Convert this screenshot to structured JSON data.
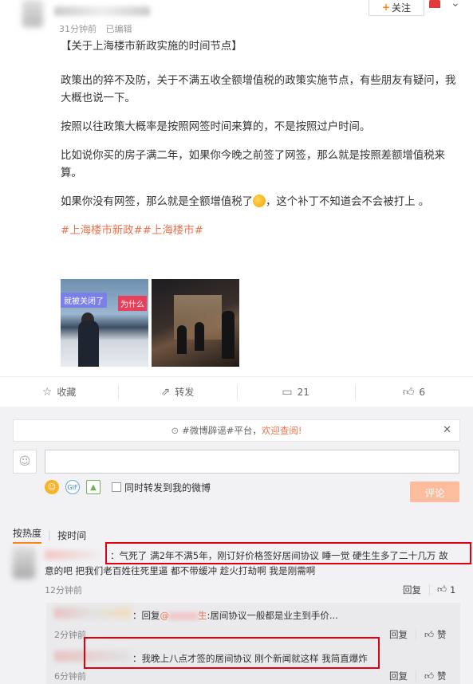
{
  "header": {
    "follow_label": "关注",
    "follow_plus": "+",
    "time": "31分钟前",
    "edit_label": "已编辑"
  },
  "post": {
    "title": "【关于上海楼市新政实施的时间节点】",
    "para1": "政策出的猝不及防，关于不满五收全额增值税的政策实施节点，有些朋友有疑问，我大概也说一下。",
    "para2": "按照以往政策大概率是按照网签时间来算的，不是按照过户时间。",
    "para3": "比如说你买的房子满二年，如果你今晚之前签了网签，那么就是按照差额增值税来算。",
    "para4_a": "如果你没有网签，那么就是全额增值税了",
    "para4_b": "，这个补丁不知道会不会被打上 。",
    "tags": "#上海楼市新政##上海楼市#",
    "image1_tag1": "就被关闭了",
    "image1_tag2": "为什么"
  },
  "actions": {
    "collect": "收藏",
    "repost": "转发",
    "comment_count": "21",
    "like_count": "6"
  },
  "comments_area": {
    "notice_prefix": "#微博辟谣#平台，",
    "notice_highlight": "欢迎查阅!",
    "sync_label": "同时转发到我的微博",
    "submit_label": "评论",
    "sort_hot": "按热度",
    "sort_time": "按时间"
  },
  "comments": [
    {
      "text_line1": "：气死了 满2年不满5年，刚订好价格签好居间协议  睡一觉 硬生生多了二十几万  故",
      "text_line2": "意的吧 把我们老百姓往死里逼 都不带缓冲 趁火打劫啊 我是刚需啊",
      "time": "12分钟前",
      "reply_label": "回复",
      "like_count": "1"
    }
  ],
  "sub_comments": [
    {
      "prefix": "：回复",
      "at": "@",
      "at_suffix": "生",
      "text": ":居间协议一般都是业主到手价...",
      "time": "2分钟前",
      "reply_label": "回复",
      "like_label": "赞"
    },
    {
      "text": "：我晚上八点才签的居间协议 刚个新闻就这样 我简直爆炸",
      "time": "6分钟前",
      "reply_label": "回复",
      "like_label": "赞"
    }
  ],
  "colors": {
    "accent": "#eb7350",
    "annotation": "#e00012",
    "submit_bg": "#fbbd9e"
  }
}
